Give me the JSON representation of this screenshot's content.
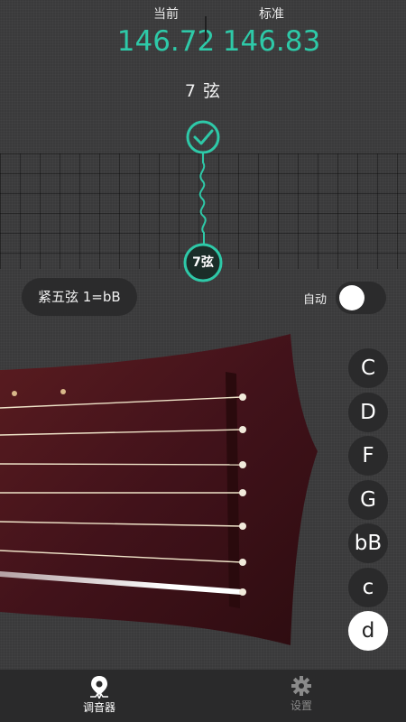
{
  "readout": {
    "current_label": "当前",
    "current_value": "146.72",
    "standard_label": "标准",
    "standard_value": "146.83"
  },
  "string_title": "7 弦",
  "meter": {
    "marker_label": "7弦",
    "in_tune": true
  },
  "tuning_label": "紧五弦 1=bB",
  "auto": {
    "label": "自动",
    "enabled": false
  },
  "notes": [
    {
      "label": "C",
      "active": false
    },
    {
      "label": "D",
      "active": false
    },
    {
      "label": "F",
      "active": false
    },
    {
      "label": "G",
      "active": false
    },
    {
      "label": "bB",
      "active": false
    },
    {
      "label": "c",
      "active": false
    },
    {
      "label": "d",
      "active": true
    }
  ],
  "tabs": [
    {
      "label": "调音器",
      "icon": "tuner-icon",
      "active": true
    },
    {
      "label": "设置",
      "icon": "gear-icon",
      "active": false
    }
  ],
  "colors": {
    "accent": "#2ec9a8",
    "background": "#3a3a3b",
    "wood": "#4a1418"
  }
}
